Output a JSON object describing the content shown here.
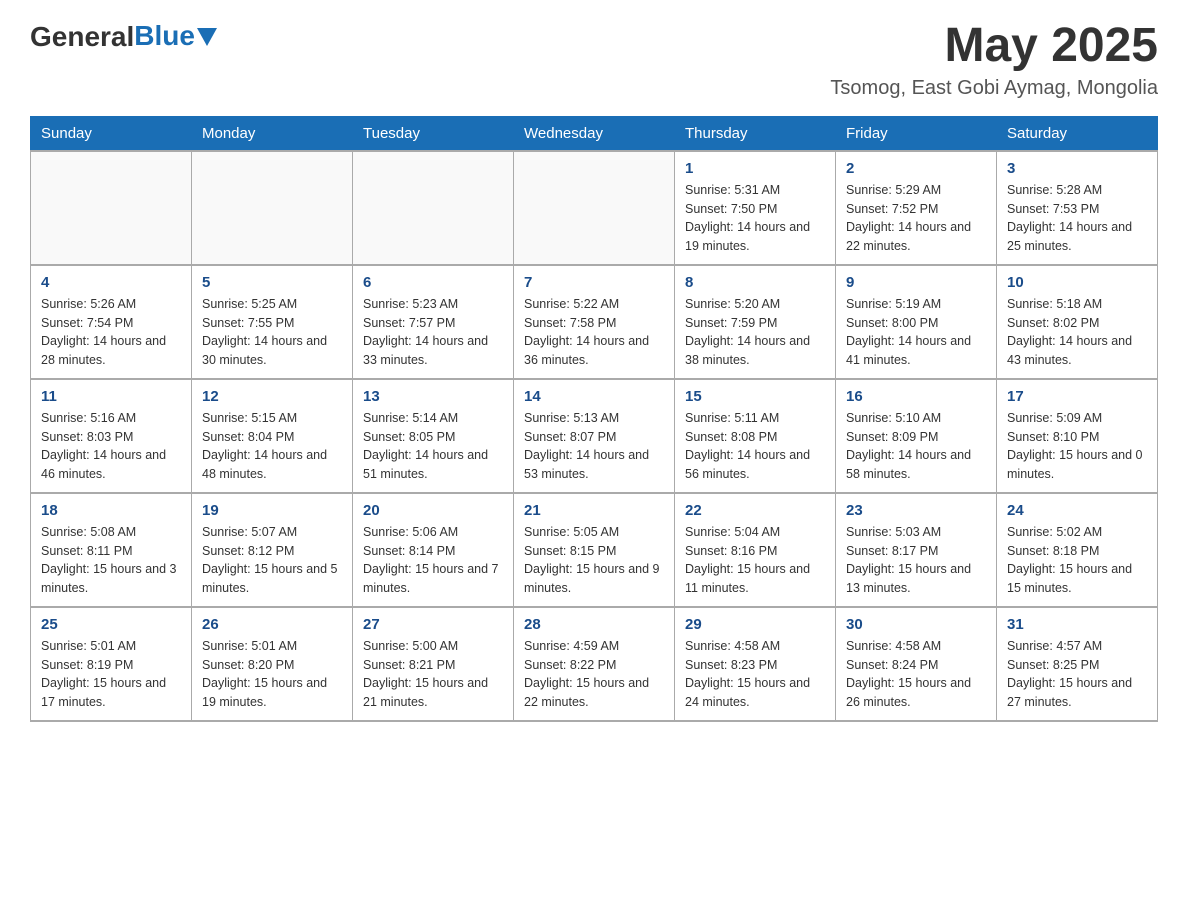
{
  "header": {
    "logo": {
      "general": "General",
      "blue": "Blue"
    },
    "title": "May 2025",
    "location": "Tsomog, East Gobi Aymag, Mongolia"
  },
  "days_of_week": [
    "Sunday",
    "Monday",
    "Tuesday",
    "Wednesday",
    "Thursday",
    "Friday",
    "Saturday"
  ],
  "weeks": [
    [
      {
        "day": "",
        "sunrise": "",
        "sunset": "",
        "daylight": ""
      },
      {
        "day": "",
        "sunrise": "",
        "sunset": "",
        "daylight": ""
      },
      {
        "day": "",
        "sunrise": "",
        "sunset": "",
        "daylight": ""
      },
      {
        "day": "",
        "sunrise": "",
        "sunset": "",
        "daylight": ""
      },
      {
        "day": "1",
        "sunrise": "Sunrise: 5:31 AM",
        "sunset": "Sunset: 7:50 PM",
        "daylight": "Daylight: 14 hours and 19 minutes."
      },
      {
        "day": "2",
        "sunrise": "Sunrise: 5:29 AM",
        "sunset": "Sunset: 7:52 PM",
        "daylight": "Daylight: 14 hours and 22 minutes."
      },
      {
        "day": "3",
        "sunrise": "Sunrise: 5:28 AM",
        "sunset": "Sunset: 7:53 PM",
        "daylight": "Daylight: 14 hours and 25 minutes."
      }
    ],
    [
      {
        "day": "4",
        "sunrise": "Sunrise: 5:26 AM",
        "sunset": "Sunset: 7:54 PM",
        "daylight": "Daylight: 14 hours and 28 minutes."
      },
      {
        "day": "5",
        "sunrise": "Sunrise: 5:25 AM",
        "sunset": "Sunset: 7:55 PM",
        "daylight": "Daylight: 14 hours and 30 minutes."
      },
      {
        "day": "6",
        "sunrise": "Sunrise: 5:23 AM",
        "sunset": "Sunset: 7:57 PM",
        "daylight": "Daylight: 14 hours and 33 minutes."
      },
      {
        "day": "7",
        "sunrise": "Sunrise: 5:22 AM",
        "sunset": "Sunset: 7:58 PM",
        "daylight": "Daylight: 14 hours and 36 minutes."
      },
      {
        "day": "8",
        "sunrise": "Sunrise: 5:20 AM",
        "sunset": "Sunset: 7:59 PM",
        "daylight": "Daylight: 14 hours and 38 minutes."
      },
      {
        "day": "9",
        "sunrise": "Sunrise: 5:19 AM",
        "sunset": "Sunset: 8:00 PM",
        "daylight": "Daylight: 14 hours and 41 minutes."
      },
      {
        "day": "10",
        "sunrise": "Sunrise: 5:18 AM",
        "sunset": "Sunset: 8:02 PM",
        "daylight": "Daylight: 14 hours and 43 minutes."
      }
    ],
    [
      {
        "day": "11",
        "sunrise": "Sunrise: 5:16 AM",
        "sunset": "Sunset: 8:03 PM",
        "daylight": "Daylight: 14 hours and 46 minutes."
      },
      {
        "day": "12",
        "sunrise": "Sunrise: 5:15 AM",
        "sunset": "Sunset: 8:04 PM",
        "daylight": "Daylight: 14 hours and 48 minutes."
      },
      {
        "day": "13",
        "sunrise": "Sunrise: 5:14 AM",
        "sunset": "Sunset: 8:05 PM",
        "daylight": "Daylight: 14 hours and 51 minutes."
      },
      {
        "day": "14",
        "sunrise": "Sunrise: 5:13 AM",
        "sunset": "Sunset: 8:07 PM",
        "daylight": "Daylight: 14 hours and 53 minutes."
      },
      {
        "day": "15",
        "sunrise": "Sunrise: 5:11 AM",
        "sunset": "Sunset: 8:08 PM",
        "daylight": "Daylight: 14 hours and 56 minutes."
      },
      {
        "day": "16",
        "sunrise": "Sunrise: 5:10 AM",
        "sunset": "Sunset: 8:09 PM",
        "daylight": "Daylight: 14 hours and 58 minutes."
      },
      {
        "day": "17",
        "sunrise": "Sunrise: 5:09 AM",
        "sunset": "Sunset: 8:10 PM",
        "daylight": "Daylight: 15 hours and 0 minutes."
      }
    ],
    [
      {
        "day": "18",
        "sunrise": "Sunrise: 5:08 AM",
        "sunset": "Sunset: 8:11 PM",
        "daylight": "Daylight: 15 hours and 3 minutes."
      },
      {
        "day": "19",
        "sunrise": "Sunrise: 5:07 AM",
        "sunset": "Sunset: 8:12 PM",
        "daylight": "Daylight: 15 hours and 5 minutes."
      },
      {
        "day": "20",
        "sunrise": "Sunrise: 5:06 AM",
        "sunset": "Sunset: 8:14 PM",
        "daylight": "Daylight: 15 hours and 7 minutes."
      },
      {
        "day": "21",
        "sunrise": "Sunrise: 5:05 AM",
        "sunset": "Sunset: 8:15 PM",
        "daylight": "Daylight: 15 hours and 9 minutes."
      },
      {
        "day": "22",
        "sunrise": "Sunrise: 5:04 AM",
        "sunset": "Sunset: 8:16 PM",
        "daylight": "Daylight: 15 hours and 11 minutes."
      },
      {
        "day": "23",
        "sunrise": "Sunrise: 5:03 AM",
        "sunset": "Sunset: 8:17 PM",
        "daylight": "Daylight: 15 hours and 13 minutes."
      },
      {
        "day": "24",
        "sunrise": "Sunrise: 5:02 AM",
        "sunset": "Sunset: 8:18 PM",
        "daylight": "Daylight: 15 hours and 15 minutes."
      }
    ],
    [
      {
        "day": "25",
        "sunrise": "Sunrise: 5:01 AM",
        "sunset": "Sunset: 8:19 PM",
        "daylight": "Daylight: 15 hours and 17 minutes."
      },
      {
        "day": "26",
        "sunrise": "Sunrise: 5:01 AM",
        "sunset": "Sunset: 8:20 PM",
        "daylight": "Daylight: 15 hours and 19 minutes."
      },
      {
        "day": "27",
        "sunrise": "Sunrise: 5:00 AM",
        "sunset": "Sunset: 8:21 PM",
        "daylight": "Daylight: 15 hours and 21 minutes."
      },
      {
        "day": "28",
        "sunrise": "Sunrise: 4:59 AM",
        "sunset": "Sunset: 8:22 PM",
        "daylight": "Daylight: 15 hours and 22 minutes."
      },
      {
        "day": "29",
        "sunrise": "Sunrise: 4:58 AM",
        "sunset": "Sunset: 8:23 PM",
        "daylight": "Daylight: 15 hours and 24 minutes."
      },
      {
        "day": "30",
        "sunrise": "Sunrise: 4:58 AM",
        "sunset": "Sunset: 8:24 PM",
        "daylight": "Daylight: 15 hours and 26 minutes."
      },
      {
        "day": "31",
        "sunrise": "Sunrise: 4:57 AM",
        "sunset": "Sunset: 8:25 PM",
        "daylight": "Daylight: 15 hours and 27 minutes."
      }
    ]
  ]
}
